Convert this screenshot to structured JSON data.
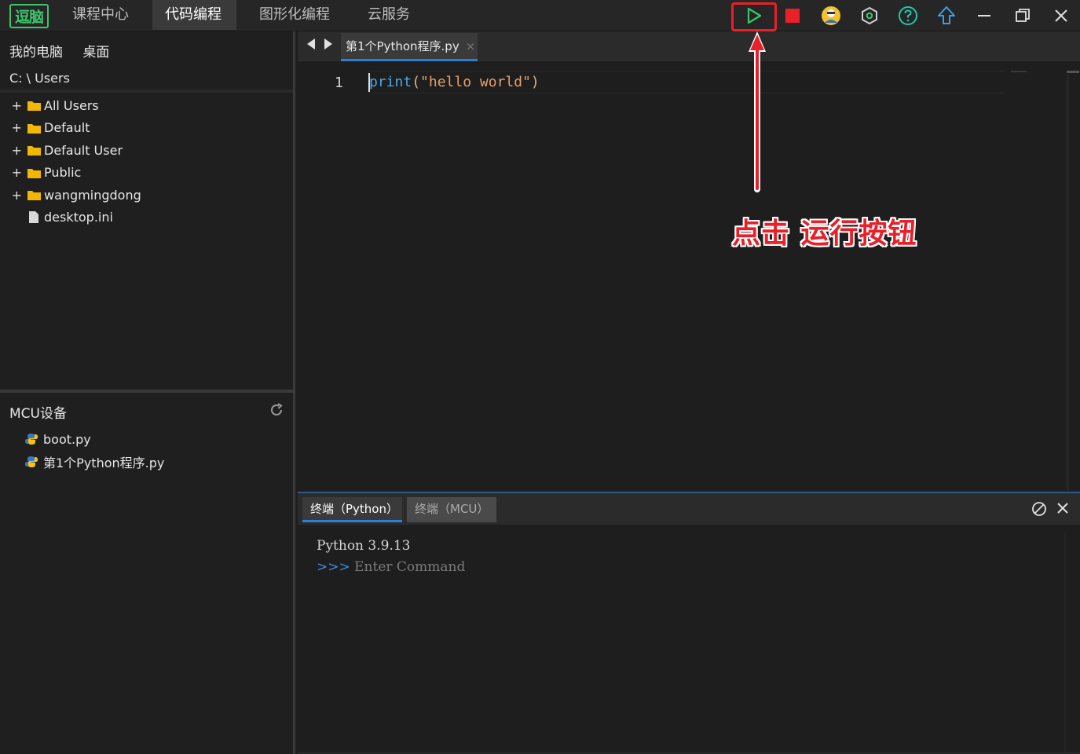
{
  "app": {
    "logo_text": "逗脑",
    "nav_tabs": [
      {
        "label": "课程中心"
      },
      {
        "label": "代码编程"
      },
      {
        "label": "图形化编程"
      },
      {
        "label": "云服务"
      }
    ],
    "active_nav": "代码编程"
  },
  "toolbar": {
    "icons": [
      "run-icon",
      "stop-icon",
      "user-avatar-icon",
      "settings-hex-icon",
      "help-icon",
      "upload-icon",
      "minimize-icon",
      "restore-icon",
      "close-icon"
    ]
  },
  "sidebar": {
    "location_tabs": [
      "我的电脑",
      "桌面"
    ],
    "path": "C: \\ Users",
    "tree": [
      {
        "type": "folder",
        "label": "All Users"
      },
      {
        "type": "folder",
        "label": "Default"
      },
      {
        "type": "folder",
        "label": "Default User"
      },
      {
        "type": "folder",
        "label": "Public"
      },
      {
        "type": "folder",
        "label": "wangmingdong"
      },
      {
        "type": "file",
        "label": "desktop.ini"
      }
    ],
    "mcu_title": "MCU设备",
    "mcu_files": [
      "boot.py",
      "第1个Python程序.py"
    ]
  },
  "editor": {
    "tab_label": "第1个Python程序.py",
    "tab_close": "×",
    "line_number": "1",
    "code": {
      "fn": "print",
      "open": "(",
      "str": "\"hello world\"",
      "close": ")"
    }
  },
  "annotation": {
    "text": "点击 运行按钮",
    "color": "#e8202a"
  },
  "terminal": {
    "tabs": [
      "终端（Python）",
      "终端（MCU）"
    ],
    "version_line": "Python 3.9.13",
    "prompt": ">>>",
    "placeholder": " Enter Command"
  },
  "colors": {
    "accent": "#2d7fd6",
    "run": "#3ec46d",
    "stop": "#e8202a",
    "folder": "#f2b705"
  }
}
